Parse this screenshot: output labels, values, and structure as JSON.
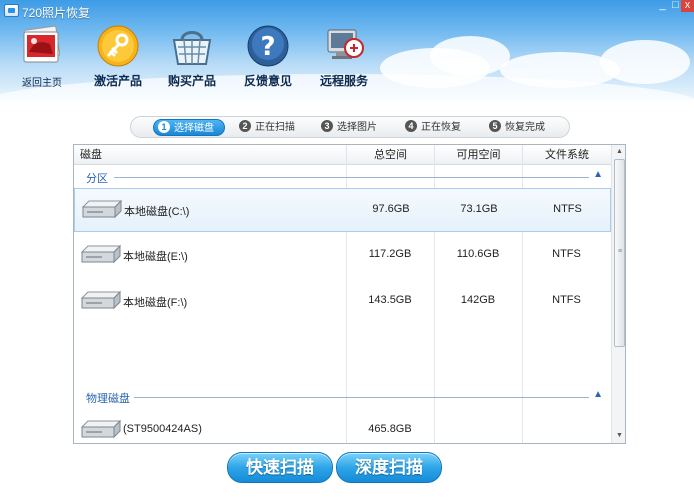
{
  "window": {
    "title": "720照片恢复",
    "controls": {
      "minimize": "_",
      "maximize": "□",
      "close": "x"
    }
  },
  "nav": {
    "home": {
      "label": "返回主页",
      "icon": "photo-album-icon"
    },
    "items": [
      {
        "label": "激活产品",
        "icon": "key-icon"
      },
      {
        "label": "购买产品",
        "icon": "shopping-basket-icon"
      },
      {
        "label": "反馈意见",
        "icon": "help-question-icon"
      },
      {
        "label": "远程服务",
        "icon": "remote-computer-icon"
      }
    ]
  },
  "steps": [
    {
      "num": "1",
      "label": "选择磁盘",
      "active": true
    },
    {
      "num": "2",
      "label": "正在扫描",
      "active": false
    },
    {
      "num": "3",
      "label": "选择图片",
      "active": false
    },
    {
      "num": "4",
      "label": "正在恢复",
      "active": false
    },
    {
      "num": "5",
      "label": "恢复完成",
      "active": false
    }
  ],
  "table": {
    "headers": {
      "disk": "磁盘",
      "total": "总空间",
      "free": "可用空间",
      "fs": "文件系统"
    },
    "partition_group": "分区",
    "partitions": [
      {
        "name": "本地磁盘(C:\\)",
        "total": "97.6GB",
        "free": "73.1GB",
        "fs": "NTFS",
        "selected": true
      },
      {
        "name": "本地磁盘(E:\\)",
        "total": "117.2GB",
        "free": "110.6GB",
        "fs": "NTFS",
        "selected": false
      },
      {
        "name": "本地磁盘(F:\\)",
        "total": "143.5GB",
        "free": "142GB",
        "fs": "NTFS",
        "selected": false
      }
    ],
    "physical_group": "物理磁盘",
    "physical": [
      {
        "name": "(ST9500424AS)",
        "total": "465.8GB",
        "free": "",
        "fs": ""
      }
    ],
    "collapse_symbol": "▲"
  },
  "buttons": {
    "quick_scan": "快速扫描",
    "deep_scan": "深度扫描"
  },
  "colors": {
    "accent": "#1a86d6",
    "group_text": "#2a64b0",
    "button_top": "#7cd3fa",
    "button_bottom": "#158cd8"
  }
}
